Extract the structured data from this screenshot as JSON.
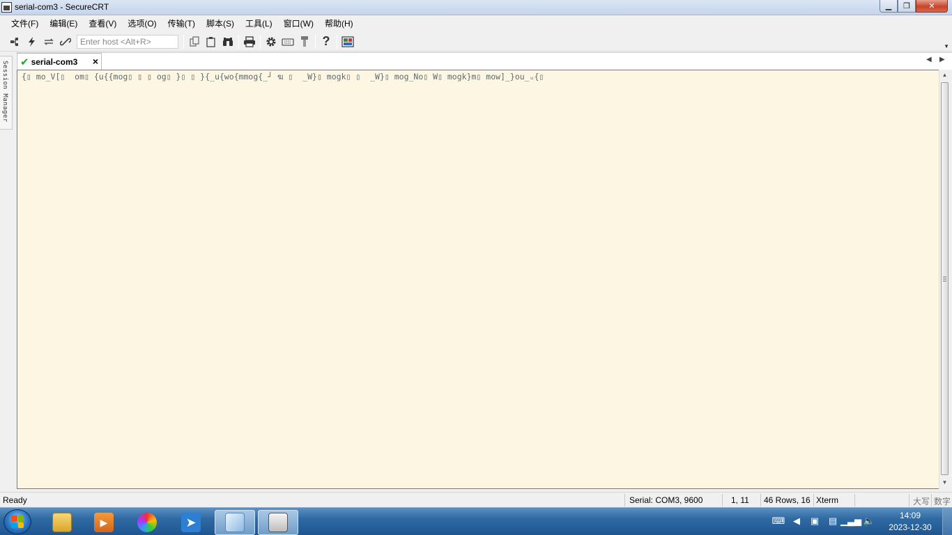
{
  "window": {
    "title": "serial-com3 - SecureCRT",
    "minimize_glyph": "▁",
    "restore_glyph": "❐",
    "close_glyph": "✕"
  },
  "menu": [
    "文件(F)",
    "编辑(E)",
    "查看(V)",
    "选项(O)",
    "传输(T)",
    "脚本(S)",
    "工具(L)",
    "窗口(W)",
    "帮助(H)"
  ],
  "toolbar": {
    "host_placeholder": "Enter host <Alt+R>",
    "icons": [
      "connect-icon",
      "quick-connect-icon",
      "reconnect-icon",
      "disconnect-icon",
      "copy-icon",
      "paste-icon",
      "find-icon",
      "print-icon",
      "settings-icon",
      "keymap-icon",
      "sftp-icon",
      "help-icon",
      "screen-icon"
    ]
  },
  "side_panel": {
    "label": "Session Manager"
  },
  "tabs": [
    {
      "label": "serial-com3",
      "status": "connected"
    }
  ],
  "terminal": {
    "output": "{▯ mo_V[▯  om▯ {u{{mog▯ ▯ ▯ og▯ }▯ ▯ }{_u{wo{mmog{_┘ ฆ ▯  _W}▯ mogk▯ ▯  _W}▯ mog_No▯ W▯ mogk}m▯ mow]_}ou_ᵤ{▯",
    "background": "#fdf6e3",
    "foreground": "#5a6a73"
  },
  "status": {
    "state": "Ready",
    "connection": "Serial: COM3, 9600",
    "cursor": "1,  11",
    "size": "46 Rows, 16",
    "emulation": "Xterm",
    "caps": "大写",
    "num": "数字"
  },
  "taskbar": {
    "time": "14:09",
    "date": "2023-12-30"
  }
}
